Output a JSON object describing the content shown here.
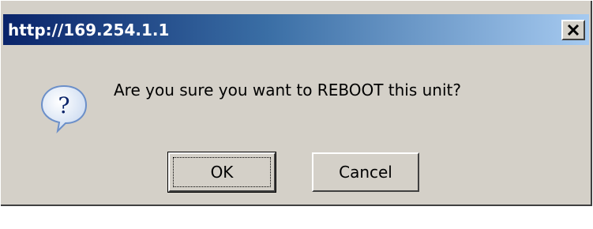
{
  "window": {
    "title": "http://169.254.1.1"
  },
  "dialog": {
    "icon": "question-icon",
    "message": "Are you sure you want to REBOOT this unit?",
    "buttons": {
      "ok_label": "OK",
      "cancel_label": "Cancel"
    }
  },
  "colors": {
    "titlebar_start": "#0a246a",
    "titlebar_end": "#a6caf0",
    "dialog_bg": "#d4d0c8"
  }
}
